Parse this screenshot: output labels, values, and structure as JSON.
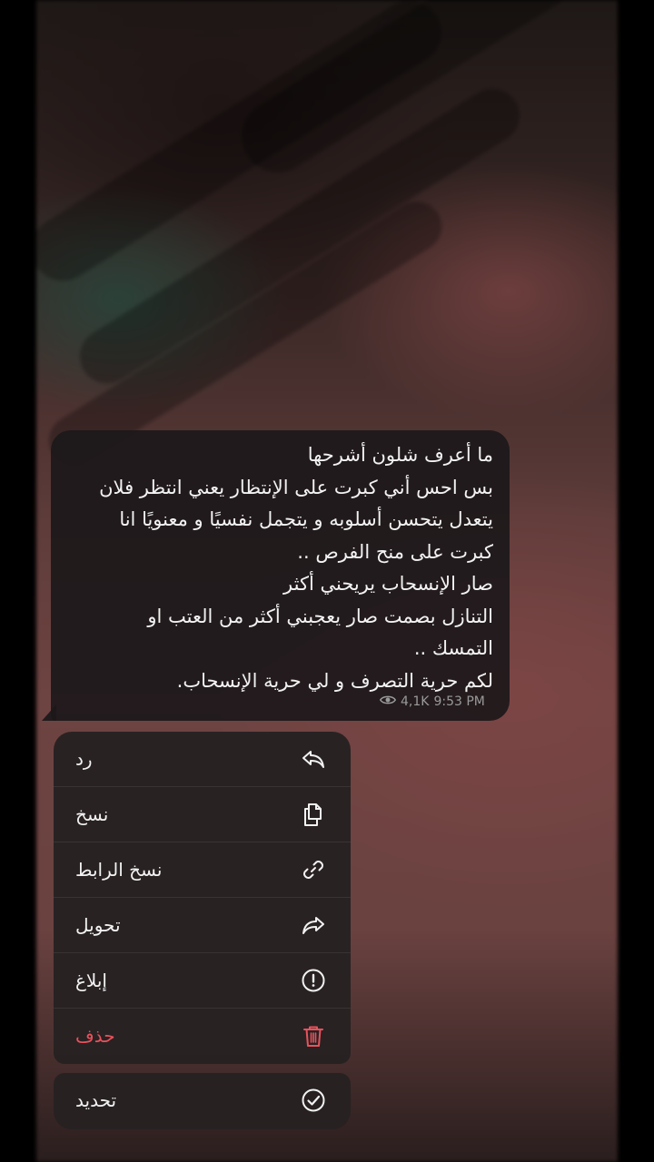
{
  "message": {
    "lines": [
      "ما أعرف شلون أشرحها",
      " بس احس أني كبرت على الإنتظار يعني انتظر فلان",
      " يتعدل يتحسن أسلوبه و يتجمل نفسيًا و معنويًا انا",
      " كبرت على منح الفرص ..",
      "صار الإنسحاب يريحني أكثر",
      " التنازل بصمت صار يعجبني أكثر من العتب او",
      " التمسك ..",
      "لكم حرية التصرف و لي حرية الإنسحاب."
    ],
    "views": "4,1K",
    "time": "9:53 PM"
  },
  "menu": {
    "items": [
      {
        "label": "رد",
        "icon": "reply-icon"
      },
      {
        "label": "نسخ",
        "icon": "copy-icon"
      },
      {
        "label": "نسخ الرابط",
        "icon": "link-icon"
      },
      {
        "label": "تحويل",
        "icon": "forward-icon"
      },
      {
        "label": "إبلاغ",
        "icon": "report-icon"
      },
      {
        "label": "حذف",
        "icon": "delete-icon"
      }
    ],
    "select": {
      "label": "تحديد",
      "icon": "select-icon"
    }
  },
  "colors": {
    "danger": "#e9525c",
    "bubble": "#1c181a",
    "menu": "#262122"
  }
}
